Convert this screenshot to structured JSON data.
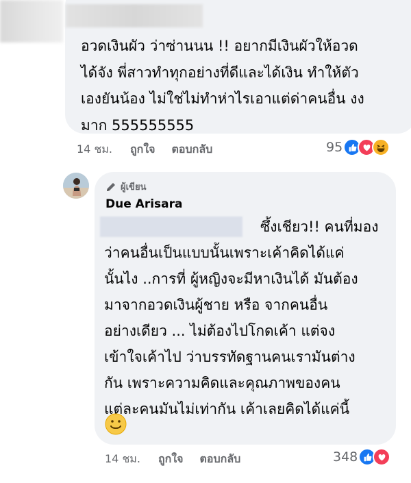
{
  "comment1": {
    "text": "อวดเงินผัว ว่าซ่านนน !! อยากมีเงินผัวให้อวด\nได้จัง พี่สาวทำทุกอย่างที่ดีและได้เงิน ทำให้ตัว\nเองยันน้อง ไม่ใช่ไม่ทำห่าไรเอาแต่ด่าคนอื่น งง\nมาก 555555555",
    "time": "14 ชม.",
    "like_label": "ถูกใจ",
    "reply_label": "ตอบกลับ",
    "reaction_count": "95",
    "reactions": [
      "like-icon",
      "love-icon",
      "haha-icon"
    ]
  },
  "comment2": {
    "author_badge": "ผู้เขียน",
    "author_name": "Due Arisara",
    "text": "ซึ้งเชียว!! คนที่มอง\nว่าคนอื่นเป็นแบบนั้นเพราะเค้าคิดได้แค่\nนั้นไง ..การที่ ผู้หญิงจะมีหาเงินได้ มันต้อง\nมาจากอวดเงินผู้ชาย หรือ จากคนอื่น\nอย่างเดียว ... ไม่ต้องไปโกดเค้า แต่จง\nเข้าใจเค้าไป ว่าบรรทัดฐานคนเรามันต่าง\nกัน เพราะความคิดและคุณภาพของคน\nแต่ละคนมันไม่เท่ากัน เค้าเลยคิดได้แค่นี้",
    "time": "14 ชม.",
    "like_label": "ถูกใจ",
    "reply_label": "ตอบกลับ",
    "reaction_count": "348",
    "reactions": [
      "like-icon",
      "love-icon"
    ]
  },
  "colors": {
    "bubble": "#f0f2f5",
    "meta_text": "#65676b",
    "like_blue": "#1877f2",
    "love_red": "#f33e58",
    "haha_yellow": "#f7b125"
  }
}
